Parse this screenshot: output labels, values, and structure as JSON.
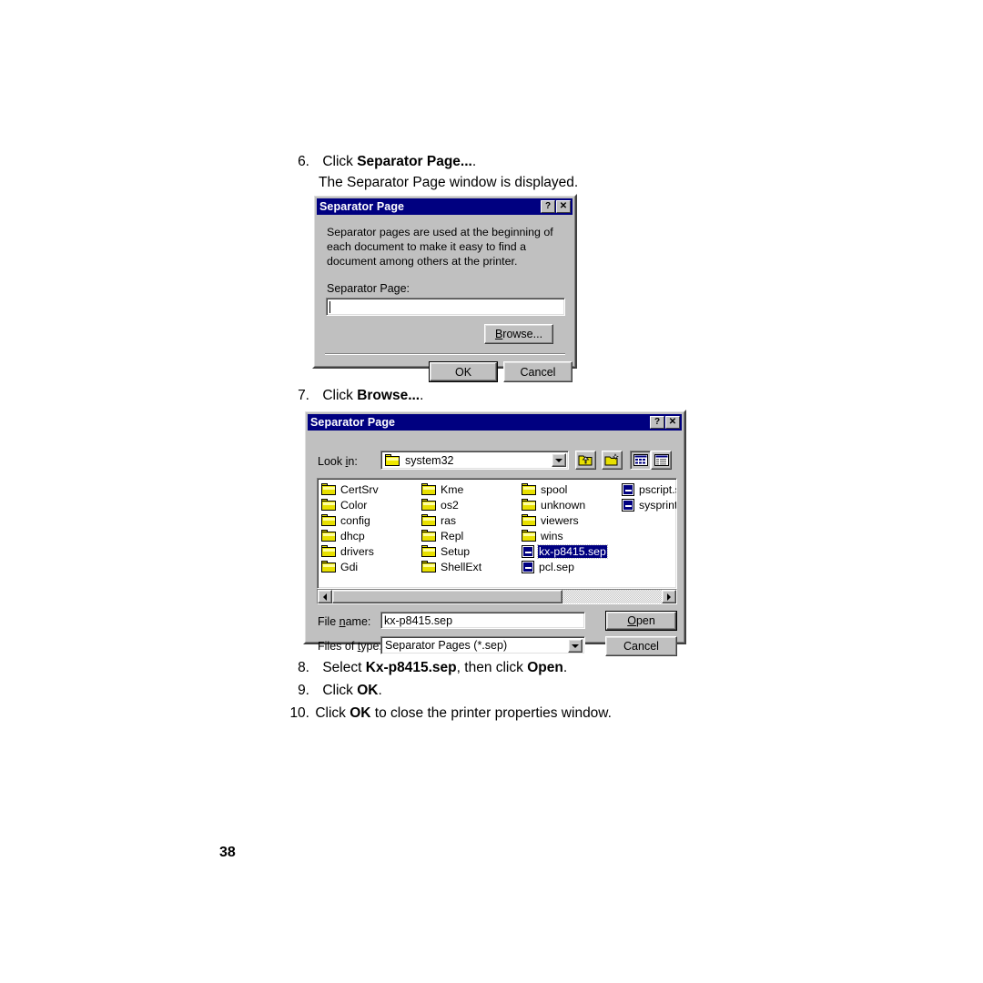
{
  "page": {
    "number": "38"
  },
  "steps": {
    "s6": {
      "num": "6.",
      "pre": "Click ",
      "bold": "Separator Page...",
      "post": ".",
      "sub": "The Separator Page window is displayed."
    },
    "s7": {
      "num": "7.",
      "pre": "Click ",
      "bold": "Browse...",
      "post": "."
    },
    "s8": {
      "num": "8.",
      "pre": "Select ",
      "bold": "Kx-p8415.sep",
      "mid": ", then click ",
      "bold2": "Open",
      "post": "."
    },
    "s9": {
      "num": "9.",
      "pre": "Click ",
      "bold": "OK",
      "post": "."
    },
    "s10": {
      "num": "10.",
      "pre": "Click ",
      "bold": "OK",
      "post": " to close the printer properties window."
    }
  },
  "separator_dialog": {
    "title": "Separator Page",
    "help_button": "?",
    "close_button": "✕",
    "description": "Separator pages are used at the beginning of each document to make it easy to find a document among others at the printer.",
    "field_label": "Separator Page:",
    "field_value": "",
    "browse_label": "Browse...",
    "ok_label": "OK",
    "cancel_label": "Cancel"
  },
  "browse_dialog": {
    "title": "Separator Page",
    "help_button": "?",
    "close_button": "✕",
    "lookin_label": "Look in:",
    "lookin_value": "system32",
    "toolbar": {
      "up_one_level": "up-one-level",
      "new_folder": "create-new-folder",
      "list_view": "list-view",
      "details_view": "details-view"
    },
    "file_columns": [
      {
        "items": [
          {
            "name": "CertSrv",
            "type": "folder",
            "selected": false
          },
          {
            "name": "Color",
            "type": "folder",
            "selected": false
          },
          {
            "name": "config",
            "type": "folder",
            "selected": false
          },
          {
            "name": "dhcp",
            "type": "folder",
            "selected": false
          },
          {
            "name": "drivers",
            "type": "folder",
            "selected": false
          },
          {
            "name": "Gdi",
            "type": "folder",
            "selected": false
          }
        ]
      },
      {
        "items": [
          {
            "name": "Kme",
            "type": "folder",
            "selected": false
          },
          {
            "name": "os2",
            "type": "folder",
            "selected": false
          },
          {
            "name": "ras",
            "type": "folder",
            "selected": false
          },
          {
            "name": "Repl",
            "type": "folder",
            "selected": false
          },
          {
            "name": "Setup",
            "type": "folder",
            "selected": false
          },
          {
            "name": "ShellExt",
            "type": "folder",
            "selected": false
          }
        ]
      },
      {
        "items": [
          {
            "name": "spool",
            "type": "folder",
            "selected": false
          },
          {
            "name": "unknown",
            "type": "folder",
            "selected": false
          },
          {
            "name": "viewers",
            "type": "folder",
            "selected": false
          },
          {
            "name": "wins",
            "type": "folder",
            "selected": false
          },
          {
            "name": "kx-p8415.sep",
            "type": "file",
            "selected": true
          },
          {
            "name": "pcl.sep",
            "type": "file",
            "selected": false
          }
        ]
      },
      {
        "items": [
          {
            "name": "pscript.sep",
            "type": "file",
            "selected": false
          },
          {
            "name": "sysprint.se",
            "type": "file",
            "selected": false
          }
        ]
      }
    ],
    "filename_label": "File name:",
    "filename_value": "kx-p8415.sep",
    "filetype_label": "Files of type:",
    "filetype_value": "Separator Pages (*.sep)",
    "open_label": "Open",
    "cancel_label": "Cancel"
  },
  "colors": {
    "titlebar": "#000080",
    "face": "#c0c0c0",
    "selection": "#000080",
    "folder": "#e8e000"
  }
}
